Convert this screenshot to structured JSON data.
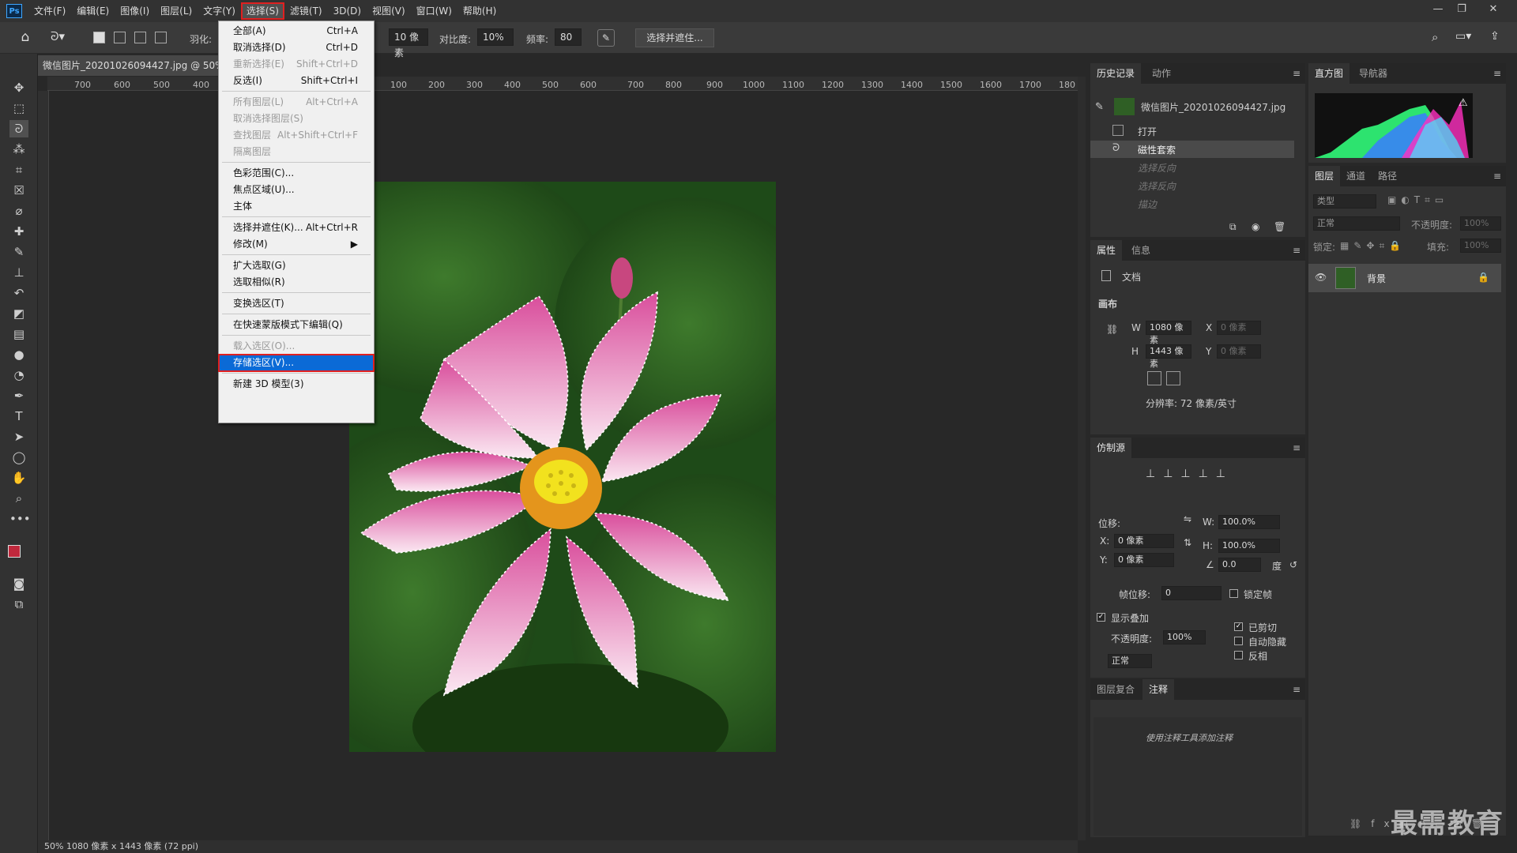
{
  "app": {
    "logo": "Ps"
  },
  "menubar": {
    "items": [
      "文件(F)",
      "编辑(E)",
      "图像(I)",
      "图层(L)",
      "文字(Y)",
      "选择(S)",
      "滤镜(T)",
      "3D(D)",
      "视图(V)",
      "窗口(W)",
      "帮助(H)"
    ],
    "active": "选择(S)"
  },
  "window": {
    "minimize": "—",
    "restore": "❐",
    "close": "✕"
  },
  "options": {
    "feather_label": "羽化:",
    "width_value": "10 像素",
    "contrast_label": "对比度:",
    "contrast_value": "10%",
    "freq_label": "频率:",
    "freq_value": "80",
    "select_mask_button": "选择并遮住..."
  },
  "document": {
    "tab_title": "微信图片_20201026094427.jpg @ 50%",
    "status": "50%   1080 像素 x 1443 像素 (72 ppi)"
  },
  "ruler": {
    "h_ticks": [
      "700",
      "600",
      "500",
      "400",
      "100",
      "200",
      "300",
      "400",
      "500",
      "600",
      "700",
      "800",
      "900",
      "1000",
      "1100",
      "1200",
      "1300",
      "1400",
      "1500",
      "1600",
      "1700",
      "180"
    ]
  },
  "select_menu": {
    "groups": [
      [
        {
          "label": "全部(A)",
          "shortcut": "Ctrl+A",
          "enabled": true
        },
        {
          "label": "取消选择(D)",
          "shortcut": "Ctrl+D",
          "enabled": true
        },
        {
          "label": "重新选择(E)",
          "shortcut": "Shift+Ctrl+D",
          "enabled": false
        },
        {
          "label": "反选(I)",
          "shortcut": "Shift+Ctrl+I",
          "enabled": true
        }
      ],
      [
        {
          "label": "所有图层(L)",
          "shortcut": "Alt+Ctrl+A",
          "enabled": false
        },
        {
          "label": "取消选择图层(S)",
          "shortcut": "",
          "enabled": false
        },
        {
          "label": "查找图层",
          "shortcut": "Alt+Shift+Ctrl+F",
          "enabled": false
        },
        {
          "label": "隔离图层",
          "shortcut": "",
          "enabled": false
        }
      ],
      [
        {
          "label": "色彩范围(C)...",
          "shortcut": "",
          "enabled": true
        },
        {
          "label": "焦点区域(U)...",
          "shortcut": "",
          "enabled": true
        },
        {
          "label": "主体",
          "shortcut": "",
          "enabled": true
        }
      ],
      [
        {
          "label": "选择并遮住(K)...",
          "shortcut": "Alt+Ctrl+R",
          "enabled": true
        },
        {
          "label": "修改(M)",
          "shortcut": "▶",
          "enabled": true
        }
      ],
      [
        {
          "label": "扩大选取(G)",
          "shortcut": "",
          "enabled": true
        },
        {
          "label": "选取相似(R)",
          "shortcut": "",
          "enabled": true
        }
      ],
      [
        {
          "label": "变换选区(T)",
          "shortcut": "",
          "enabled": true
        }
      ],
      [
        {
          "label": "在快速蒙版模式下编辑(Q)",
          "shortcut": "",
          "enabled": true
        }
      ],
      [
        {
          "label": "载入选区(O)...",
          "shortcut": "",
          "enabled": false
        },
        {
          "label": "存储选区(V)...",
          "shortcut": "",
          "enabled": true,
          "highlighted": true
        }
      ],
      [
        {
          "label": "新建 3D 模型(3)",
          "shortcut": "",
          "enabled": true
        }
      ]
    ]
  },
  "history_panel": {
    "tabs": [
      "历史记录",
      "动作"
    ],
    "snapshot": "微信图片_20201026094427.jpg",
    "items": [
      {
        "label": "打开",
        "state": "normal"
      },
      {
        "label": "磁性套索",
        "state": "current"
      },
      {
        "label": "选择反向",
        "state": "undone"
      },
      {
        "label": "选择反向",
        "state": "undone"
      },
      {
        "label": "描边",
        "state": "undone"
      }
    ]
  },
  "properties_panel": {
    "tabs": [
      "属性",
      "信息"
    ],
    "doc_label": "文档",
    "section": "画布",
    "w_label": "W",
    "w_value": "1080 像素",
    "h_label": "H",
    "h_value": "1443 像素",
    "x_label": "X",
    "x_value": "0 像素",
    "y_label": "Y",
    "y_value": "0 像素",
    "resolution": "分辨率: 72 像素/英寸"
  },
  "clone_panel": {
    "tab": "仿制源",
    "offset_label": "位移:",
    "x_label": "X:",
    "x_value": "0 像素",
    "y_label": "Y:",
    "y_value": "0 像素",
    "w_label": "W:",
    "w_value": "100.0%",
    "h_label": "H:",
    "h_value": "100.0%",
    "angle_value": "0.0",
    "degree": "度",
    "frame_label": "帧位移:",
    "frame_value": "0",
    "lock_frame": "锁定帧",
    "show_overlay": "显示叠加",
    "opacity_label": "不透明度:",
    "opacity_value": "100%",
    "mode": "正常",
    "clipped": "已剪切",
    "autohide": "自动隐藏",
    "invert": "反相"
  },
  "notes_panel": {
    "tabs": [
      "图层复合",
      "注释"
    ],
    "hint": "使用注释工具添加注释"
  },
  "histogram_panel": {
    "tabs": [
      "直方图",
      "导航器"
    ]
  },
  "layers_panel": {
    "tabs": [
      "图层",
      "通道",
      "路径"
    ],
    "kind_placeholder": "类型",
    "blend_mode": "正常",
    "opacity_label": "不透明度:",
    "opacity_value": "100%",
    "lock_label": "锁定:",
    "fill_label": "填充:",
    "fill_value": "100%",
    "layer_name": "背景"
  },
  "watermark": "最需教育",
  "colors": {
    "accent": "#0b6ad6",
    "highlight_border": "#e02020",
    "foreground": "#c0283c",
    "background": "#2ab0c8"
  }
}
